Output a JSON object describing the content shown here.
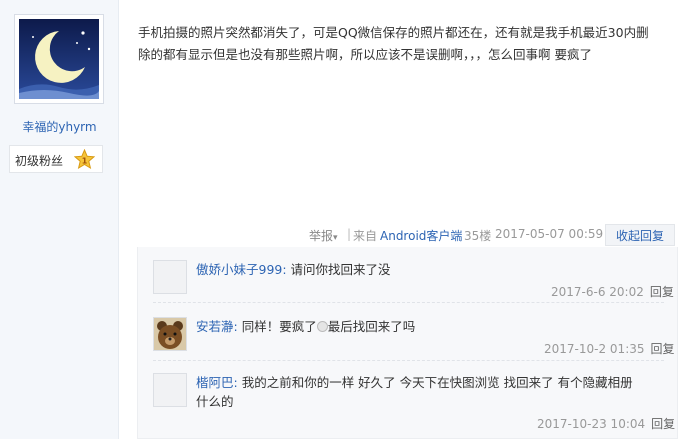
{
  "user": {
    "name": "幸福的yhyrm",
    "level_label": "初级粉丝",
    "level_number": "1"
  },
  "post": {
    "line1": "手机拍摄的照片突然都消失了，可是QQ微信保存的照片都还在，还有就是我手机最近30内删",
    "line2": "除的都有显示但是也没有那些照片啊，所以应该不是误删啊，，，怎么回事啊 要疯了"
  },
  "tail": {
    "report": "举报",
    "separator": "|",
    "from": "来自",
    "client": "Android客户端",
    "floor": "35楼",
    "time": "2017-05-07 00:59",
    "collapse": "收起回复"
  },
  "replies": [
    {
      "name": "傲娇小妹子999:",
      "text": " 请问你找回来了没",
      "time": "2017-6-6 20:02",
      "reply_label": "回复"
    },
    {
      "name": "安若瀞:",
      "text_before": " 同样！要疯了",
      "text_after": "最后找回来了吗",
      "time": "2017-10-2 01:35",
      "reply_label": "回复"
    },
    {
      "name": "楷阿巴:",
      "text": " 我的之前和你的一样 好久了 今天下在快图浏览 找回来了 有个隐藏相册",
      "text_line2": "什么的",
      "time": "2017-10-23 10:04",
      "reply_label": "回复"
    }
  ],
  "colors": {
    "link": "#2d64b3",
    "sidebar_bg": "#f4f7fb",
    "replies_bg": "#f7f8fa"
  }
}
